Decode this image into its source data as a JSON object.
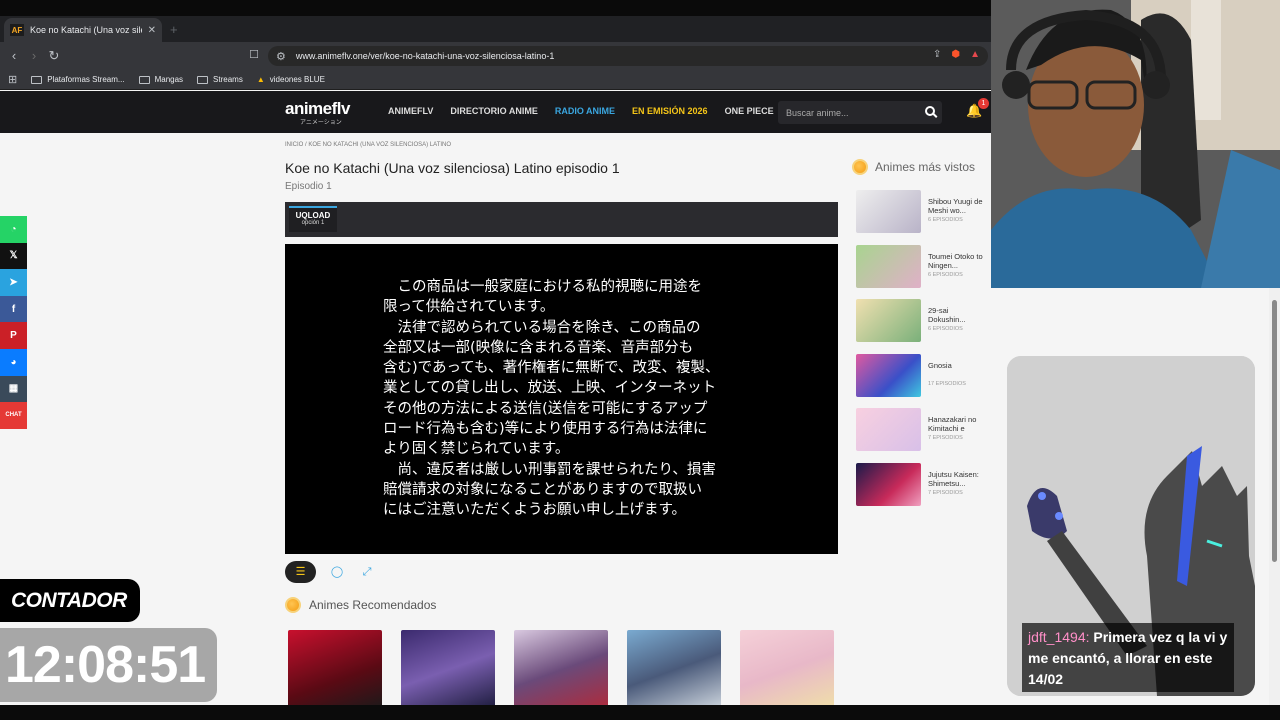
{
  "browser": {
    "tab_title": "Koe no Katachi (Una voz silencio",
    "tab_favicon": "AF",
    "url": "www.animeflv.one/ver/koe-no-katachi-una-voz-silenciosa-latino-1",
    "bookmarks": [
      "Plataformas Stream...",
      "Mangas",
      "Streams",
      "videones BLUE"
    ]
  },
  "site": {
    "logo": "animeflv",
    "logo_sub": "アニメーション",
    "nav": [
      "ANIMEFLV",
      "DIRECTORIO ANIME",
      "RADIO ANIME",
      "EN EMISIÓN 2026",
      "ONE PIECE"
    ],
    "search_placeholder": "Buscar anime...",
    "notifications": "1"
  },
  "page": {
    "breadcrumb": "INICIO  /  KOE NO KATACHI (UNA VOZ SILENCIOSA) LATINO",
    "title": "Koe no Katachi (Una voz silenciosa) Latino episodio 1",
    "subtitle": "Episodio 1",
    "server": {
      "name": "UQLOAD",
      "option": "opción 1"
    },
    "player_text": [
      "　この商品は一般家庭における私的視聴に用途を",
      "限って供給されています。",
      "　法律で認められている場合を除き、この商品の",
      "全部又は一部(映像に含まれる音楽、音声部分も",
      "含む)であっても、著作権者に無断で、改変、複製、",
      "業としての貸し出し、放送、上映、インターネット",
      "その他の方法による送信(送信を可能にするアップ",
      "ロード行為も含む)等により使用する行為は法律に",
      "より固く禁じられています。",
      "　尚、違反者は厳しい刑事罰を課せられたり、損害",
      "賠償請求の対象になることがありますので取扱い",
      "にはご注意いただくようお願い申し上げます。"
    ],
    "recommended_title": "Animes Recomendados"
  },
  "sidebar": {
    "title": "Animes más vistos",
    "items": [
      {
        "name": "Shibou Yuugi de Meshi wo...",
        "eps": "6 EPISODIOS",
        "color": "#c9c4d6"
      },
      {
        "name": "Toumei Otoko to Ningen...",
        "eps": "6 EPISODIOS",
        "color": "#8fbf7a"
      },
      {
        "name": "29-sai Dokushin...",
        "eps": "6 EPISODIOS",
        "color": "#9cc3a0"
      },
      {
        "name": "Gnosia",
        "eps": "17 EPISODIOS",
        "color": "#5a5fb8"
      },
      {
        "name": "Hanazakari no Kimitachi e",
        "eps": "7 EPISODIOS",
        "color": "#e8c3d4"
      },
      {
        "name": "Jujutsu Kaisen: Shimetsu...",
        "eps": "7 EPISODIOS",
        "color": "#3a3a7a"
      }
    ]
  },
  "share": [
    "whatsapp",
    "x",
    "telegram",
    "facebook",
    "pinterest",
    "messenger",
    "qr",
    "CHAT"
  ],
  "overlay": {
    "counter_label": "CONTADOR",
    "timer": "12:08:51",
    "chat_user": "jdft_1494:",
    "chat_text": "Primera vez q la vi y me encantó, a llorar en este 14/02"
  }
}
